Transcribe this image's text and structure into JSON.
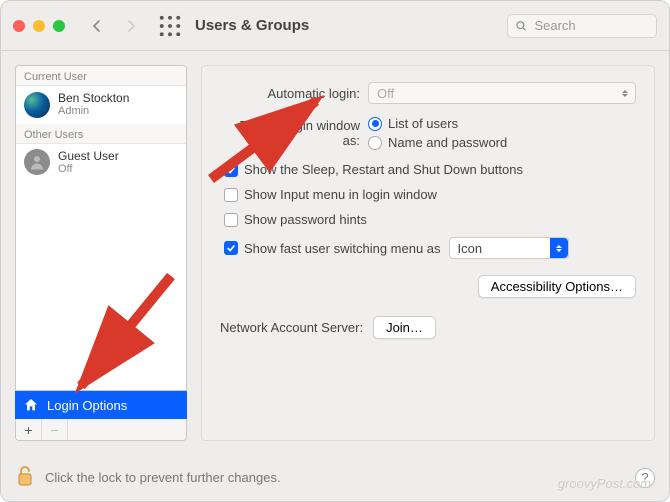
{
  "window": {
    "title": "Users & Groups",
    "search_placeholder": "Search"
  },
  "sidebar": {
    "current_header": "Current User",
    "other_header": "Other Users",
    "current_user": {
      "name": "Ben Stockton",
      "role": "Admin"
    },
    "other_users": [
      {
        "name": "Guest User",
        "role": "Off"
      }
    ],
    "login_options_label": "Login Options"
  },
  "main": {
    "automatic_login_label": "Automatic login:",
    "automatic_login_value": "Off",
    "display_label": "Display login window as:",
    "radio_list": "List of users",
    "radio_namepass": "Name and password",
    "chk_sleep": "Show the Sleep, Restart and Shut Down buttons",
    "chk_input": "Show Input menu in login window",
    "chk_hints": "Show password hints",
    "chk_fastswitch": "Show fast user switching menu as",
    "fastswitch_value": "Icon",
    "accessibility_btn": "Accessibility Options…",
    "network_label": "Network Account Server:",
    "join_btn": "Join…"
  },
  "footer": {
    "lock_text": "Click the lock to prevent further changes.",
    "watermark": "groovyPost.com"
  }
}
